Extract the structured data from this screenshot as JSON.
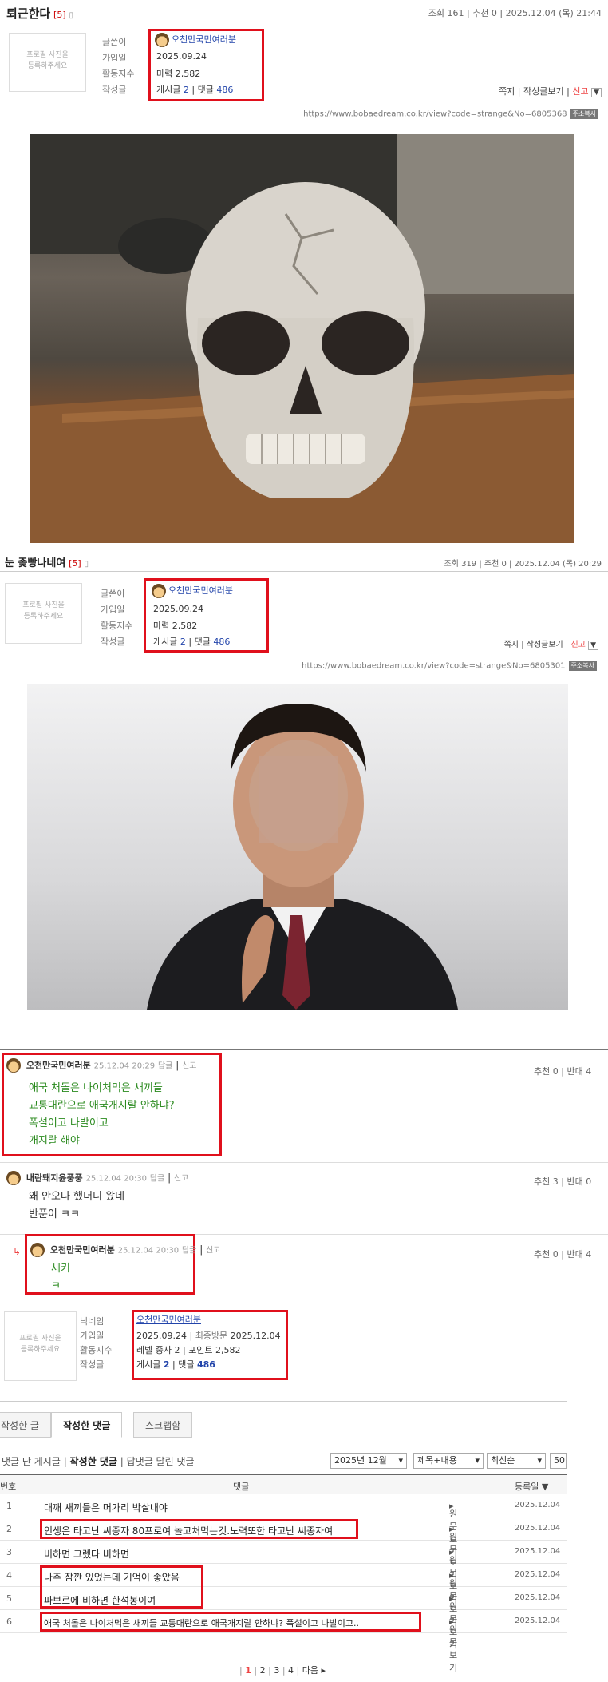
{
  "post1": {
    "title": "퇴근한다",
    "comment_count": "[5]",
    "meta": "조회 161  |  추천 0  |  2025.12.04 (목) 21:44",
    "url": "https://www.bobaedream.co.kr/view?code=strange&No=6805368",
    "image_desc": "skull-shaped container on table"
  },
  "post2": {
    "title": "눈 좆빵나네여",
    "comment_count": "[5]",
    "meta": "조회 319  |  추천 0  |  2025.12.04 (목) 20:29",
    "url": "https://www.bobaedream.co.kr/view?code=strange&No=6805301"
  },
  "profile": {
    "placeholder": "프로필 사진을\n등록하주세요",
    "labels": [
      "글쓴이",
      "가입일",
      "활동지수",
      "작성글"
    ],
    "nickname": "오천만국민여러분",
    "join_date": "2025.09.24",
    "activity": "마력 2,582",
    "posts_label": "게시글",
    "posts_count": "2",
    "comments_label": "댓글",
    "comments_count": "486",
    "actions": [
      "쪽지",
      "작성글보기",
      "신고"
    ],
    "copy_badge": "주소복사"
  },
  "comments": [
    {
      "name": "오천만국민여러분",
      "date": "25.12.04 20:29",
      "reply": "답글",
      "report": "신고",
      "rec": "추천 0",
      "opp": "반대 4",
      "lines": [
        "애국 처돌은 나이처먹은 새끼들",
        "교통대란으로 애국개지랄 안하냐?",
        "폭설이고 나발이고",
        "개지랄 해야"
      ]
    },
    {
      "name": "내란돼지윤풍풍",
      "date": "25.12.04 20:30",
      "reply": "답글",
      "report": "신고",
      "rec": "추천 3",
      "opp": "반대 0",
      "lines": [
        "왜 안오나 했더니 왔네",
        "반푼이 ㅋㅋ"
      ]
    },
    {
      "name": "오천만국민여러분",
      "date": "25.12.04 20:30",
      "reply": "답글",
      "report": "신고",
      "rec": "추천 0",
      "opp": "반대 4",
      "lines": [
        "새키",
        "ㅋ"
      ]
    }
  ],
  "profile2": {
    "labels": [
      "닉네임",
      "가입일",
      "활동지수",
      "작성글"
    ],
    "nickname": "오천만국민여러분",
    "join": "2025.09.24",
    "last_visit_label": "최종방문",
    "last_visit": "2025.12.04",
    "level": "레벨 중사 2",
    "points": "포인트 2,582",
    "posts_label": "게시글",
    "posts_count": "2",
    "comments_label": "댓글",
    "comments_count": "486"
  },
  "tabs": [
    "작성한 글",
    "작성한 댓글",
    "스크랩함"
  ],
  "subtabs": [
    "댓글 단 게시글",
    "작성한 댓글",
    "답댓글 달린 댓글"
  ],
  "filters": {
    "month": "2025년 12월",
    "field": "제목+내용",
    "sort": "최신순",
    "count": "50"
  },
  "table": {
    "headers": [
      "번호",
      "댓글",
      "등록일"
    ],
    "rows": [
      {
        "num": "1",
        "text": "대깨 새끼들은 머가리 박살내야",
        "view": "원문보기",
        "date": "2025.12.04"
      },
      {
        "num": "2",
        "text": "인생은 타고난 씨종자 80프로여 놀고처먹는것.노력또한 타고난 씨종자여",
        "view": "원문보기",
        "date": "2025.12.04"
      },
      {
        "num": "3",
        "text": "비하면 그렜다 비하면",
        "view": "원문보기",
        "date": "2025.12.04"
      },
      {
        "num": "4",
        "text": "나주 잠깐 있었는데 기억이 좋았음",
        "view": "원문보기",
        "date": "2025.12.04"
      },
      {
        "num": "5",
        "text": "파브르에 비하면 한석봉이여",
        "view": "원문보기",
        "date": "2025.12.04"
      },
      {
        "num": "6",
        "text": "애국 처돌은 나이처먹은 새끼들 교통대란으로 애국개지랄 안하냐? 폭설이고 나발이고..",
        "view": "원문보기",
        "date": "2025.12.04"
      }
    ]
  },
  "pagination": [
    "1",
    "2",
    "3",
    "4",
    "다음"
  ]
}
